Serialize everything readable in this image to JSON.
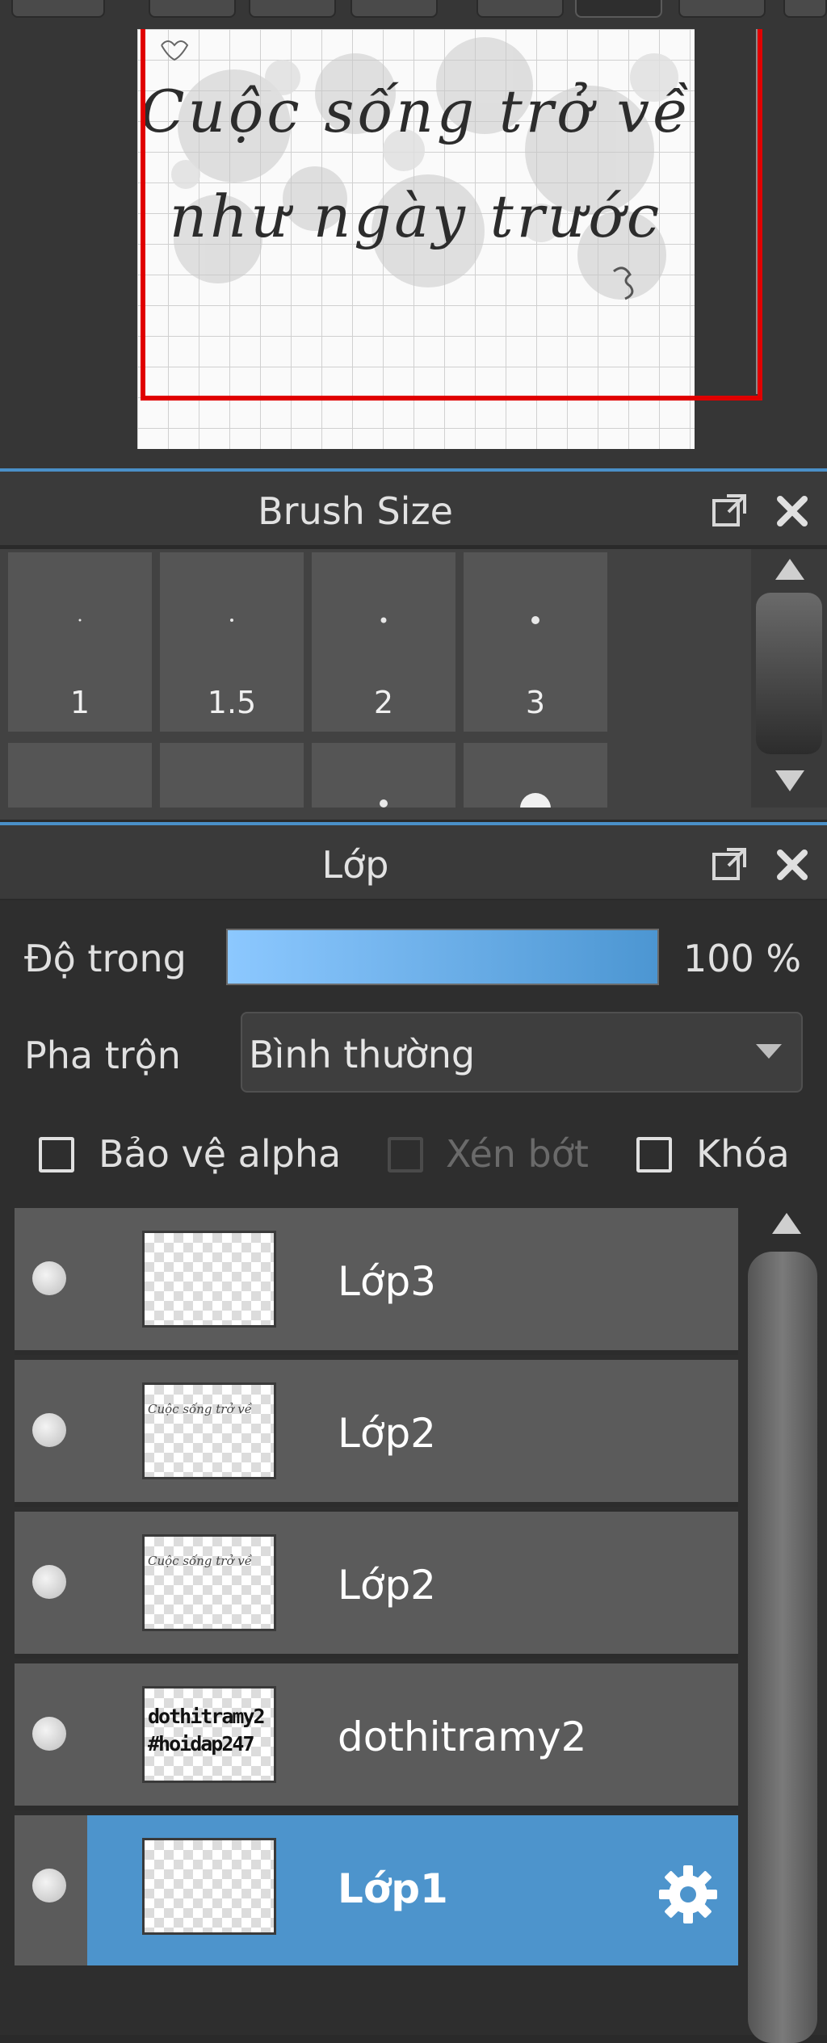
{
  "navigator": {
    "canvas_line1": "Cuộc sống trở về",
    "canvas_line2": "như ngày trước",
    "frame_color": "#e00000"
  },
  "brush_panel": {
    "title": "Brush Size",
    "undock_icon": "external-window-icon",
    "close_icon": "close-icon",
    "sizes": [
      "1",
      "1.5",
      "2",
      "3"
    ]
  },
  "layer_panel": {
    "title": "Lớp",
    "undock_icon": "external-window-icon",
    "close_icon": "close-icon",
    "opacity_label": "Độ trong",
    "opacity_value": "100 %",
    "blend_label": "Pha trộn",
    "blend_value": "Bình thường",
    "checkboxes": [
      {
        "label": "Bảo vệ alpha",
        "checked": false,
        "enabled": true
      },
      {
        "label": "Xén bớt",
        "checked": false,
        "enabled": false
      },
      {
        "label": "Khóa",
        "checked": false,
        "enabled": true
      }
    ],
    "layers": [
      {
        "name": "Lớp3",
        "selected": false
      },
      {
        "name": "Lớp2",
        "selected": false
      },
      {
        "name": "Lớp2",
        "selected": false
      },
      {
        "name": "dothitramy2",
        "selected": false,
        "thumb_text": "dothitramy2 #hoidap247"
      },
      {
        "name": "Lớp1",
        "selected": true
      }
    ],
    "settings_icon": "gear-icon",
    "accent_color": "#4d94cc"
  }
}
